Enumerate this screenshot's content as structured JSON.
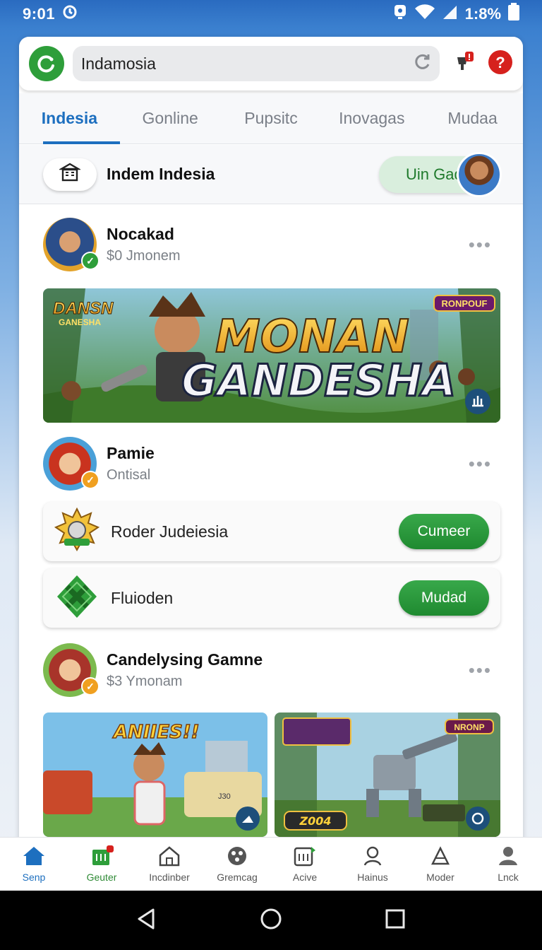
{
  "status": {
    "time": "9:01",
    "battery": "1:8%"
  },
  "search": {
    "value": "Indamosia"
  },
  "tabs": [
    {
      "label": "Indesia",
      "active": true
    },
    {
      "label": "Gonline"
    },
    {
      "label": "Pupsitc"
    },
    {
      "label": "Inovagas"
    },
    {
      "label": "Mudaa"
    }
  ],
  "subheader": {
    "title": "Indem Indesia",
    "join_label": "Uin Gads"
  },
  "posts": [
    {
      "name": "Nocakad",
      "sub": "$0 Jmonem",
      "banner": {
        "tag": "RONPOUF",
        "small_title": "DANSN",
        "small_sub": "GANESHA",
        "title_top": "MONAN",
        "title_bottom": "GANDESHA"
      }
    },
    {
      "name": "Pamie",
      "sub": "Ontisal"
    },
    {
      "name": "Candelysing Gamne",
      "sub": "$3 Ymonam"
    }
  ],
  "games": [
    {
      "title": "Roder Judeiesia",
      "button": "Cumeer"
    },
    {
      "title": "Fluioden",
      "button": "Mudad"
    }
  ],
  "thumbs": [
    {
      "title": "ANIIES!!",
      "plate": "J30"
    },
    {
      "title": "",
      "tag": "NRONP",
      "price": "Z004"
    }
  ],
  "nav": [
    {
      "label": "Senp",
      "icon": "home-icon",
      "active": true
    },
    {
      "label": "Geuter",
      "icon": "store-icon"
    },
    {
      "label": "Incdinber",
      "icon": "house-outline-icon"
    },
    {
      "label": "Gremcag",
      "icon": "gamepad-icon"
    },
    {
      "label": "Acive",
      "icon": "activity-icon"
    },
    {
      "label": "Hainus",
      "icon": "person-pin-icon"
    },
    {
      "label": "Moder",
      "icon": "pen-icon"
    },
    {
      "label": "Lnck",
      "icon": "profile-icon"
    }
  ],
  "colors": {
    "accent": "#1d6fbf",
    "green": "#2e9e3a",
    "red": "#d6211d"
  }
}
